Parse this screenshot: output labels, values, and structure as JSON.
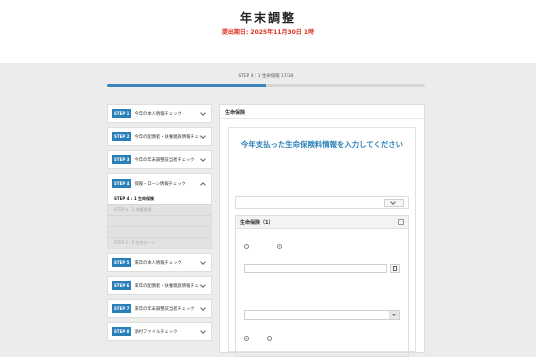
{
  "header": {
    "title": "年末調整",
    "subtitle": "",
    "deadline": "提出期日: 2025年11月30日 1時"
  },
  "progress": {
    "label": "STEP 4 : 1 生命保険   17/34",
    "fraction": 0.5
  },
  "sidebar": {
    "steps": [
      {
        "badge": "STEP 1",
        "label": "今年の本人情報チェック"
      },
      {
        "badge": "STEP 2",
        "label": "今年の配偶者・扶養親族情報チェック"
      },
      {
        "badge": "STEP 3",
        "label": "今年の年末調整該当者チェック"
      },
      {
        "badge": "STEP 4",
        "label": "保険・ローン情報チェック"
      },
      {
        "badge": "STEP 5",
        "label": "来年の本人情報チェック"
      },
      {
        "badge": "STEP 6",
        "label": "来年の配偶者・扶養親族情報チェック"
      },
      {
        "badge": "STEP 7",
        "label": "来年の年末調整該当者チェック"
      },
      {
        "badge": "STEP 8",
        "label": "添付ファイルチェック"
      }
    ],
    "substeps": [
      {
        "label": "STEP 4 : 1 生命保険"
      },
      {
        "label": "STEP 4 : 2 地震保険"
      },
      {
        "label": ""
      },
      {
        "label": ""
      },
      {
        "label": "STEP 4 : 5 住宅ローン"
      }
    ]
  },
  "main": {
    "header": "生命保険",
    "headline": "今年支払った生命保険料情報を入力してください",
    "section_title": "生命保険（1）"
  },
  "colors": {
    "accent": "#2b7fb9",
    "deadline": "#e0301e",
    "background": "#ececec"
  },
  "icons": [
    "chevron-down-icon",
    "chevron-up-icon",
    "document-icon",
    "minus-icon",
    "select-arrow-icon",
    "radio-icon"
  ]
}
